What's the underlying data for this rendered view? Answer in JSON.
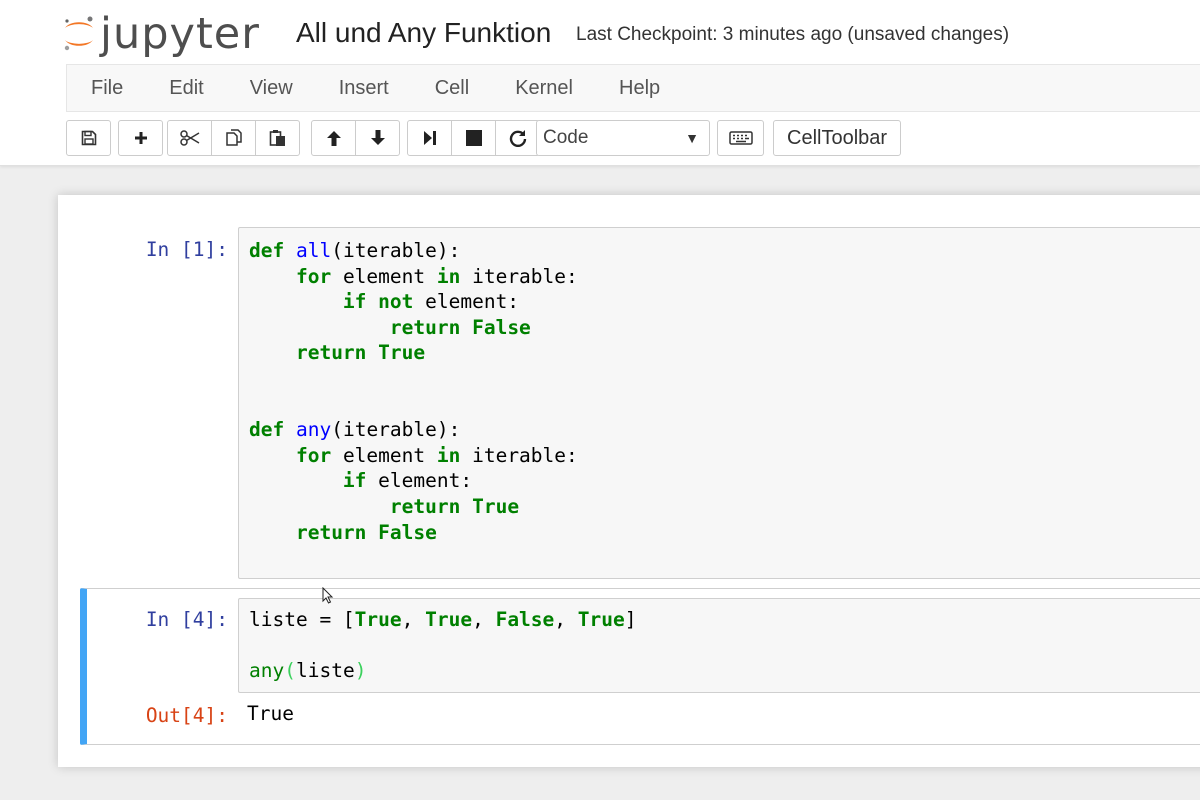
{
  "header": {
    "logo_text": "jupyter",
    "notebook_name": "All und Any Funktion",
    "checkpoint": "Last Checkpoint: 3 minutes ago (unsaved changes)"
  },
  "menu": [
    "File",
    "Edit",
    "View",
    "Insert",
    "Cell",
    "Kernel",
    "Help"
  ],
  "toolbar": {
    "icons": [
      "save-icon",
      "plus-icon",
      "scissors-icon",
      "copy-icon",
      "paste-icon",
      "arrow-up-icon",
      "arrow-down-icon",
      "step-forward-icon",
      "stop-icon",
      "refresh-icon",
      "keyboard-icon"
    ],
    "cell_type": "Code",
    "celltoolbar_label": "CellToolbar"
  },
  "cells": [
    {
      "prompt": "In [1]:",
      "source": "def all(iterable):\n    for element in iterable:\n        if not element:\n            return False\n    return True\n\n\ndef any(iterable):\n    for element in iterable:\n        if element:\n            return True\n    return False"
    },
    {
      "prompt": "In [4]:",
      "source": "liste = [True, True, False, True]\n\nany(liste)",
      "output_prompt": "Out[4]:",
      "output": "True"
    }
  ],
  "colors": {
    "keyword": "#008000",
    "in_prompt": "#303f9f",
    "out_prompt": "#d84315",
    "selected_cell": "#42a5f5",
    "logo_orange": "#f37726"
  }
}
